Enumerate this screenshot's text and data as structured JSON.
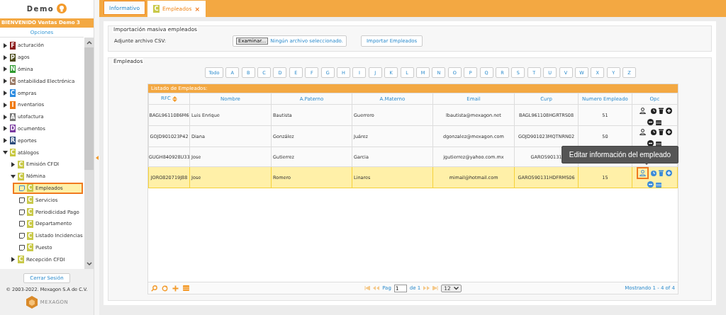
{
  "sidebar": {
    "logo": "Demo",
    "welcome": "BIENVENIDO Ventas Demo 3",
    "options_title": "Opciones",
    "menu": [
      {
        "initial": "F",
        "label": "acturación",
        "color": "#8b1a1a",
        "expanded": false
      },
      {
        "initial": "P",
        "label": "agos",
        "color": "#4a4a1a",
        "expanded": false
      },
      {
        "initial": "N",
        "label": "ómina",
        "color": "#2e9a2e",
        "expanded": false
      },
      {
        "initial": "C",
        "label": "ontabilidad Electrónica",
        "color": "#9a7a66",
        "expanded": false
      },
      {
        "initial": "C",
        "label": "ompras",
        "color": "#2a8ae0",
        "expanded": false
      },
      {
        "initial": "I",
        "label": "nventarios",
        "color": "#f07a10",
        "expanded": false
      },
      {
        "initial": "A",
        "label": "utofactura",
        "color": "#777777",
        "expanded": false
      },
      {
        "initial": "D",
        "label": "ocumentos",
        "color": "#7a3aa0",
        "expanded": false
      },
      {
        "initial": "R",
        "label": "eportes",
        "color": "#2a4a7a",
        "expanded": false
      },
      {
        "initial": "C",
        "label": "atálogos",
        "color": "#c8c840",
        "expanded": true,
        "children": [
          {
            "initial": "C",
            "label": "Emisión CFDI",
            "expanded": false
          },
          {
            "initial": "C",
            "label": "Nómina",
            "expanded": true,
            "children": [
              {
                "initial": "C",
                "label": "Empleados",
                "selected": true
              },
              {
                "initial": "C",
                "label": "Servicios",
                "selected": false
              },
              {
                "initial": "C",
                "label": "Periodicidad Pago",
                "selected": false
              },
              {
                "initial": "C",
                "label": "Departamento",
                "selected": false
              },
              {
                "initial": "C",
                "label": "Listado Incidencias",
                "selected": false
              },
              {
                "initial": "C",
                "label": "Puesto",
                "selected": false
              }
            ]
          },
          {
            "initial": "C",
            "label": "Recepción CFDI",
            "expanded": false
          }
        ]
      }
    ],
    "logout": "Cerrar Sesión",
    "copyright": "© 2003-2022. Mexagon S.A de C.V.",
    "company_logo": "MEXAGON"
  },
  "tabs": [
    {
      "label": "Informativo",
      "selected": false
    },
    {
      "label": "Empleados",
      "badge": "C",
      "close": "×",
      "selected": true
    }
  ],
  "import": {
    "legend": "Importación masiva empleados",
    "file_label": "Adjunte archivo CSV:",
    "browse_button": "Examinar...",
    "file_status": "Ningún archivo seleccionado.",
    "import_button": "Importar Empleados"
  },
  "employees": {
    "legend": "Empleados",
    "filters": [
      "Todo",
      "A",
      "B",
      "C",
      "D",
      "E",
      "F",
      "G",
      "H",
      "I",
      "J",
      "K",
      "L",
      "M",
      "N",
      "O",
      "P",
      "Q",
      "R",
      "S",
      "T",
      "U",
      "V",
      "W",
      "X",
      "Y",
      "Z"
    ],
    "table_title": "Listado de Empleados:",
    "columns": [
      "RFC",
      "Nombre",
      "A.Paterno",
      "A.Materno",
      "Email",
      "Curp",
      "Numero Empleado",
      "Opc"
    ],
    "rows": [
      {
        "rfc": "BAGL9611086M6",
        "nombre": "Luis Enrique",
        "paterno": "Bautista",
        "materno": "Guerrero",
        "email": "lbautista@mexagon.net",
        "curp": "BAGL961108HGRTRS08",
        "numero": "51",
        "actions": true,
        "selected": false
      },
      {
        "rfc": "GOJD901023P42",
        "nombre": "Diana",
        "paterno": "González",
        "materno": "Juárez",
        "email": "dgonzalez@mexagon.com",
        "curp": "GOJD901023MQTNRN02",
        "numero": "50",
        "actions": true,
        "selected": false
      },
      {
        "rfc": "GUGH840928U33",
        "nombre": "Jose",
        "paterno": "Gutierrez",
        "materno": "Garcia",
        "email": "jgutierrez@yahoo.com.mx",
        "curp": "GARO590131",
        "actions": false,
        "selected": false
      },
      {
        "rfc": "JORO820719J88",
        "nombre": "Jose",
        "paterno": "Romero",
        "materno": "Linares",
        "email": "mimail@hotmail.com",
        "curp": "GARO590131HDFRMS06",
        "numero": "15",
        "actions": true,
        "selected": true
      }
    ],
    "tooltip": "Editar información del empleado",
    "pager": {
      "page_label": "Pag",
      "page": "1",
      "of_label": "de 1",
      "page_size": "12",
      "summary": "Mostrando 1 - 4 of 4"
    }
  }
}
